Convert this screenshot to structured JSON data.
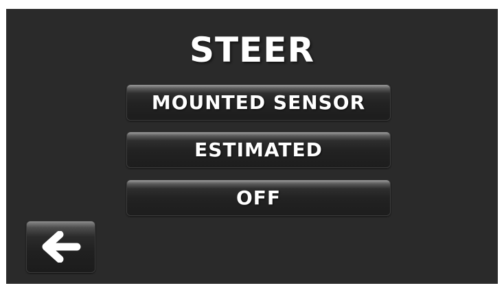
{
  "screen": {
    "title": "STEER",
    "background": "#2a2a2a"
  },
  "options": [
    {
      "label": "MOUNTED SENSOR"
    },
    {
      "label": "ESTIMATED"
    },
    {
      "label": "OFF"
    }
  ],
  "back_button": {
    "icon": "left-arrow-icon"
  }
}
